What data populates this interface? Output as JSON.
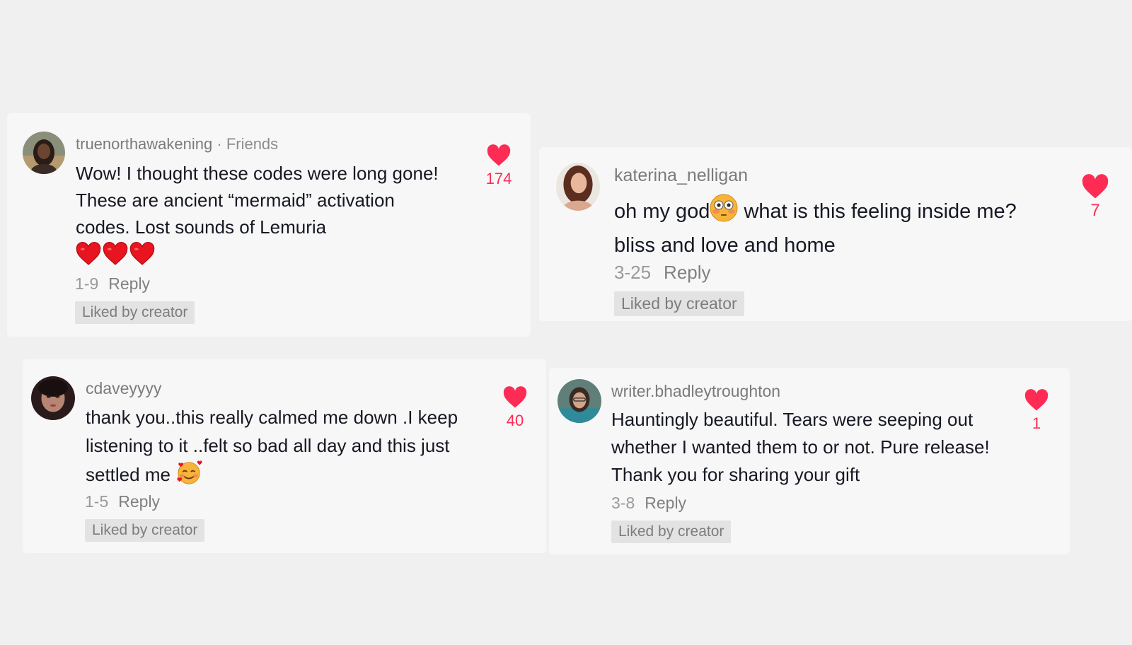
{
  "colors": {
    "like": "#fe2c55",
    "text": "#161823",
    "muted": "#7b7b7b",
    "badge_bg": "#e3e3e3"
  },
  "comments": [
    {
      "username": "truenorthawakening",
      "tag": "· Friends",
      "text": "Wow! I thought these codes were long gone! These are ancient “mermaid” activation codes. Lost sounds of Lemuria",
      "emoji": "red-heart-icon ×3",
      "date": "1-9",
      "reply": "Reply",
      "badge": "Liked by creator",
      "likes": "174"
    },
    {
      "username": "katerina_nelligan",
      "text_before": "oh my god",
      "emoji": "flushed-face-icon",
      "text_after": " what is this feeling inside me? bliss and love and home",
      "date": "3-25",
      "reply": "Reply",
      "badge": "Liked by creator",
      "likes": "7"
    },
    {
      "username": "cdaveyyyy",
      "text": "thank you..this really calmed me down .I keep listening to it ..felt so bad all day and this just settled me",
      "emoji": "smiling-face-with-hearts-icon",
      "date": "1-5",
      "reply": "Reply",
      "badge": "Liked by creator",
      "likes": "40"
    },
    {
      "username": "writer.bhadleytroughton",
      "text": "Hauntingly beautiful. Tears were seeping out whether I wanted them to or not. Pure release! Thank you for sharing your gift",
      "date": "3-8",
      "reply": "Reply",
      "badge": "Liked by creator",
      "likes": "1"
    }
  ]
}
